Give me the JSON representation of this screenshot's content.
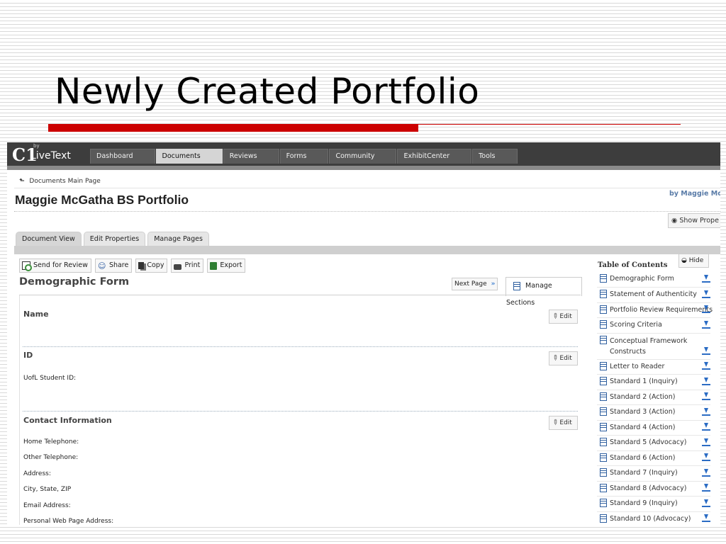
{
  "slide": {
    "title": "Newly Created Portfolio"
  },
  "app": {
    "logo_mark": "C1",
    "logo_by": "by",
    "logo_text": "LiveText",
    "nav_tabs": [
      {
        "label": "Dashboard",
        "active": false
      },
      {
        "label": "Documents",
        "active": true
      },
      {
        "label": "Reviews",
        "active": false
      },
      {
        "label": "Forms",
        "active": false
      },
      {
        "label": "Community",
        "active": false
      },
      {
        "label": "ExhibitCenter",
        "active": false
      },
      {
        "label": "Tools",
        "active": false
      }
    ]
  },
  "page": {
    "breadcrumb": "Documents Main Page",
    "title": "Maggie McGatha BS Portfolio",
    "byline": "by Maggie McG",
    "show_properties": "Show Prope",
    "tabs": [
      "Document View",
      "Edit Properties",
      "Manage Pages"
    ]
  },
  "toolbar": {
    "send_for_review": "Send for Review",
    "share": "Share",
    "copy": "Copy",
    "print": "Print",
    "export": "Export"
  },
  "form": {
    "heading": "Demographic Form",
    "next_page": "Next Page",
    "manage_sections": "Manage Sections",
    "edit_label": "Edit",
    "sections": [
      {
        "title": "Name",
        "fields": []
      },
      {
        "title": "ID",
        "fields": [
          "UofL Student ID:"
        ]
      },
      {
        "title": "Contact Information",
        "fields": [
          "Home Telephone:",
          "Other  Telephone:",
          "Address:",
          "City, State, ZIP",
          "Email Address:",
          "Personal Web Page Address:"
        ]
      }
    ]
  },
  "toc": {
    "heading": "Table of Contents",
    "hide": "Hide",
    "items": [
      "Demographic Form",
      "Statement of Authenticity",
      "Portfolio Review Requirements",
      "Scoring Criteria",
      "Conceptual Framework Constructs",
      "Letter to Reader",
      "Standard 1 (Inquiry)",
      "Standard 2 (Action)",
      "Standard 3 (Action)",
      "Standard 4 (Action)",
      "Standard 5 (Advocacy)",
      "Standard 6 (Action)",
      "Standard 7 (Inquiry)",
      "Standard 8 (Advocacy)",
      "Standard 9 (Inquiry)",
      "Standard 10 (Advocacy)"
    ]
  },
  "colors": {
    "accent_red": "#cc0000",
    "nav_dark": "#3d3d3d",
    "link_blue": "#5a7ca8"
  }
}
